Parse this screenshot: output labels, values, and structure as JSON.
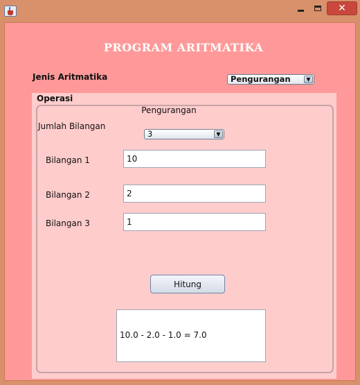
{
  "window": {
    "title": ""
  },
  "header": {
    "title": "PROGRAM ARITMATIKA"
  },
  "jenis": {
    "label": "Jenis Aritmatika",
    "selected": "Pengurangan"
  },
  "operasi": {
    "label": "Operasi",
    "subtitle": "Pengurangan",
    "jumlah_label": "Jumlah Bilangan",
    "jumlah_selected": "3",
    "fields": [
      {
        "label": "Bilangan 1",
        "value": "10"
      },
      {
        "label": "Bilangan 2",
        "value": "2"
      },
      {
        "label": "Bilangan 3",
        "value": "1"
      }
    ],
    "button_label": "Hitung",
    "result": "10.0 - 2.0 - 1.0 = 7.0"
  },
  "colors": {
    "background": "#ff9999",
    "panel": "#ffcccc",
    "titlebar": "#d8916a",
    "close": "#c9473d"
  },
  "icons": {
    "app": "java-cup-icon",
    "minimize": "minimize-icon",
    "maximize": "maximize-icon",
    "close": "close-icon",
    "dropdown": "chevron-down-icon"
  }
}
